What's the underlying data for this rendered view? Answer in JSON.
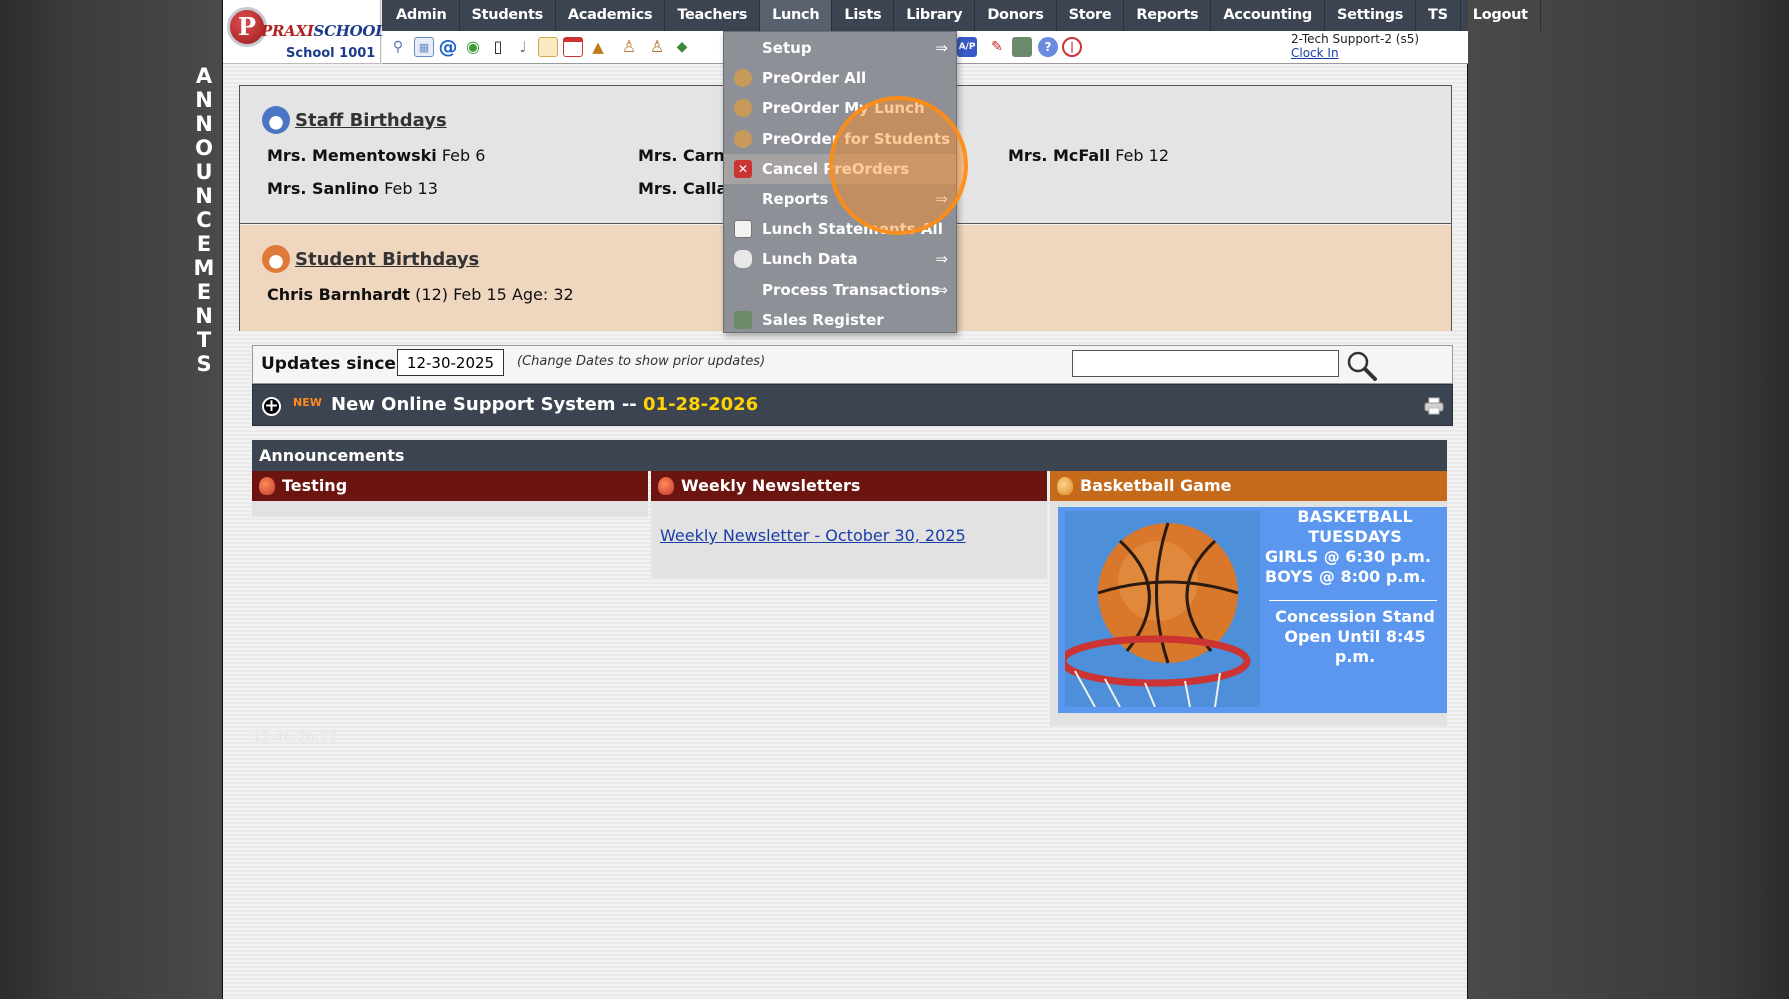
{
  "vertical_word": [
    "A",
    "N",
    "N",
    "O",
    "U",
    "N",
    "C",
    "E",
    "M",
    "E",
    "N",
    "T",
    "S"
  ],
  "logo": {
    "mark": "P",
    "brand_part1": "PRAXI",
    "brand_part2": "SCHOOL",
    "school_name": "School 1001"
  },
  "nav": [
    "Admin",
    "Students",
    "Academics",
    "Teachers",
    "Lunch",
    "Lists",
    "Library",
    "Donors",
    "Store",
    "Reports",
    "Accounting",
    "Settings",
    "TS",
    "Logout"
  ],
  "nav_active": "Lunch",
  "user": {
    "name": "2-Tech Support-2 (s5)",
    "clock_link": "Clock In"
  },
  "lunch_menu": [
    {
      "label": "Setup",
      "arrow": "⇒",
      "icon": "none"
    },
    {
      "label": "PreOrder All",
      "arrow": "",
      "icon": "person-icon"
    },
    {
      "label": "PreOrder My Lunch",
      "arrow": "",
      "icon": "person-icon"
    },
    {
      "label": "PreOrder for Students",
      "arrow": "",
      "icon": "person-icon"
    },
    {
      "label": "Cancel PreOrders",
      "arrow": "",
      "icon": "x-icon"
    },
    {
      "label": "Reports",
      "arrow": "⇒",
      "icon": "none"
    },
    {
      "label": "Lunch Statements All",
      "arrow": "",
      "icon": "statement-icon"
    },
    {
      "label": "Lunch Data",
      "arrow": "⇒",
      "icon": "database-icon"
    },
    {
      "label": "Process Transactions",
      "arrow": "⇒",
      "icon": "none"
    },
    {
      "label": "Sales Register",
      "arrow": "",
      "icon": "register-icon"
    }
  ],
  "staff_birthdays": {
    "title": "Staff Birthdays",
    "entries": [
      {
        "name": "Mrs. Mementowski",
        "date": "Feb 6"
      },
      {
        "name": "Mrs. Carna",
        "date": ""
      },
      {
        "name": "Mrs. McFall",
        "date": "Feb 12"
      },
      {
        "name": "Mrs. Sanlino",
        "date": "Feb 13"
      },
      {
        "name": "Mrs. Calla",
        "date": ""
      }
    ]
  },
  "student_birthdays": {
    "title": "Student Birthdays",
    "entries": [
      {
        "name": "Chris Barnhardt",
        "details": "(12) Feb 15 Age: 32"
      }
    ]
  },
  "updates": {
    "label": "Updates since:",
    "date": "12-30-2025",
    "note": "(Change Dates to show prior updates)",
    "search_placeholder": ""
  },
  "support_item": {
    "badge": "NEW",
    "title": "New Online Support System -- ",
    "date": "01-28-2026"
  },
  "announcements": {
    "header": "Announcements",
    "columns": [
      {
        "title": "Testing"
      },
      {
        "title": "Weekly Newsletters",
        "link": "Weekly Newsletter - October 30, 2025"
      },
      {
        "title": "Basketball Game"
      }
    ],
    "basketball": {
      "lines": [
        "BASKETBALL",
        "TUESDAYS",
        "GIRLS @ 6:30 p.m.",
        "BOYS  @ 8:00 p.m."
      ],
      "lines2": [
        "Concession Stand",
        "Open Until 8:45 p.m."
      ]
    }
  },
  "faint_timestamp": "12:46:26:32",
  "colors": {
    "nav_bg": "#3c4452",
    "maroon": "#6b1410",
    "orange": "#c56a1a",
    "link": "#1a3ea8",
    "highlight": "#ffd400",
    "bball_bg": "#5b97ef"
  }
}
